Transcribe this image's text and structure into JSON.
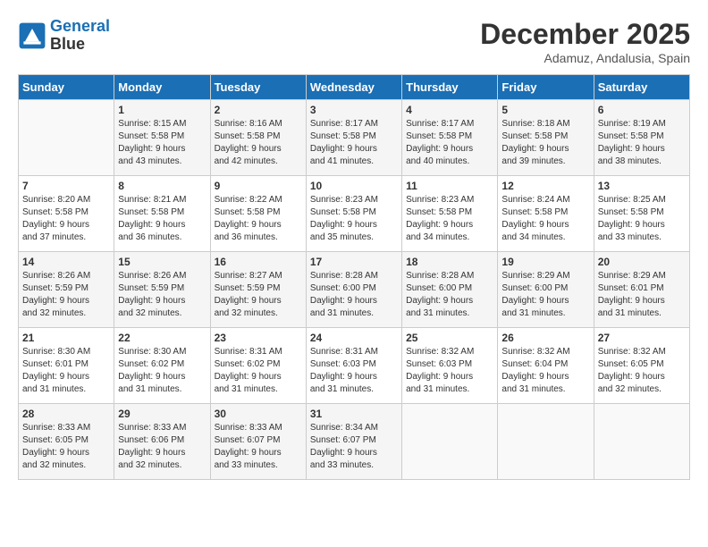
{
  "header": {
    "logo_line1": "General",
    "logo_line2": "Blue",
    "month": "December 2025",
    "location": "Adamuz, Andalusia, Spain"
  },
  "weekdays": [
    "Sunday",
    "Monday",
    "Tuesday",
    "Wednesday",
    "Thursday",
    "Friday",
    "Saturday"
  ],
  "weeks": [
    [
      {
        "day": "",
        "info": ""
      },
      {
        "day": "1",
        "info": "Sunrise: 8:15 AM\nSunset: 5:58 PM\nDaylight: 9 hours\nand 43 minutes."
      },
      {
        "day": "2",
        "info": "Sunrise: 8:16 AM\nSunset: 5:58 PM\nDaylight: 9 hours\nand 42 minutes."
      },
      {
        "day": "3",
        "info": "Sunrise: 8:17 AM\nSunset: 5:58 PM\nDaylight: 9 hours\nand 41 minutes."
      },
      {
        "day": "4",
        "info": "Sunrise: 8:17 AM\nSunset: 5:58 PM\nDaylight: 9 hours\nand 40 minutes."
      },
      {
        "day": "5",
        "info": "Sunrise: 8:18 AM\nSunset: 5:58 PM\nDaylight: 9 hours\nand 39 minutes."
      },
      {
        "day": "6",
        "info": "Sunrise: 8:19 AM\nSunset: 5:58 PM\nDaylight: 9 hours\nand 38 minutes."
      }
    ],
    [
      {
        "day": "7",
        "info": "Sunrise: 8:20 AM\nSunset: 5:58 PM\nDaylight: 9 hours\nand 37 minutes."
      },
      {
        "day": "8",
        "info": "Sunrise: 8:21 AM\nSunset: 5:58 PM\nDaylight: 9 hours\nand 36 minutes."
      },
      {
        "day": "9",
        "info": "Sunrise: 8:22 AM\nSunset: 5:58 PM\nDaylight: 9 hours\nand 36 minutes."
      },
      {
        "day": "10",
        "info": "Sunrise: 8:23 AM\nSunset: 5:58 PM\nDaylight: 9 hours\nand 35 minutes."
      },
      {
        "day": "11",
        "info": "Sunrise: 8:23 AM\nSunset: 5:58 PM\nDaylight: 9 hours\nand 34 minutes."
      },
      {
        "day": "12",
        "info": "Sunrise: 8:24 AM\nSunset: 5:58 PM\nDaylight: 9 hours\nand 34 minutes."
      },
      {
        "day": "13",
        "info": "Sunrise: 8:25 AM\nSunset: 5:58 PM\nDaylight: 9 hours\nand 33 minutes."
      }
    ],
    [
      {
        "day": "14",
        "info": "Sunrise: 8:26 AM\nSunset: 5:59 PM\nDaylight: 9 hours\nand 32 minutes."
      },
      {
        "day": "15",
        "info": "Sunrise: 8:26 AM\nSunset: 5:59 PM\nDaylight: 9 hours\nand 32 minutes."
      },
      {
        "day": "16",
        "info": "Sunrise: 8:27 AM\nSunset: 5:59 PM\nDaylight: 9 hours\nand 32 minutes."
      },
      {
        "day": "17",
        "info": "Sunrise: 8:28 AM\nSunset: 6:00 PM\nDaylight: 9 hours\nand 31 minutes."
      },
      {
        "day": "18",
        "info": "Sunrise: 8:28 AM\nSunset: 6:00 PM\nDaylight: 9 hours\nand 31 minutes."
      },
      {
        "day": "19",
        "info": "Sunrise: 8:29 AM\nSunset: 6:00 PM\nDaylight: 9 hours\nand 31 minutes."
      },
      {
        "day": "20",
        "info": "Sunrise: 8:29 AM\nSunset: 6:01 PM\nDaylight: 9 hours\nand 31 minutes."
      }
    ],
    [
      {
        "day": "21",
        "info": "Sunrise: 8:30 AM\nSunset: 6:01 PM\nDaylight: 9 hours\nand 31 minutes."
      },
      {
        "day": "22",
        "info": "Sunrise: 8:30 AM\nSunset: 6:02 PM\nDaylight: 9 hours\nand 31 minutes."
      },
      {
        "day": "23",
        "info": "Sunrise: 8:31 AM\nSunset: 6:02 PM\nDaylight: 9 hours\nand 31 minutes."
      },
      {
        "day": "24",
        "info": "Sunrise: 8:31 AM\nSunset: 6:03 PM\nDaylight: 9 hours\nand 31 minutes."
      },
      {
        "day": "25",
        "info": "Sunrise: 8:32 AM\nSunset: 6:03 PM\nDaylight: 9 hours\nand 31 minutes."
      },
      {
        "day": "26",
        "info": "Sunrise: 8:32 AM\nSunset: 6:04 PM\nDaylight: 9 hours\nand 31 minutes."
      },
      {
        "day": "27",
        "info": "Sunrise: 8:32 AM\nSunset: 6:05 PM\nDaylight: 9 hours\nand 32 minutes."
      }
    ],
    [
      {
        "day": "28",
        "info": "Sunrise: 8:33 AM\nSunset: 6:05 PM\nDaylight: 9 hours\nand 32 minutes."
      },
      {
        "day": "29",
        "info": "Sunrise: 8:33 AM\nSunset: 6:06 PM\nDaylight: 9 hours\nand 32 minutes."
      },
      {
        "day": "30",
        "info": "Sunrise: 8:33 AM\nSunset: 6:07 PM\nDaylight: 9 hours\nand 33 minutes."
      },
      {
        "day": "31",
        "info": "Sunrise: 8:34 AM\nSunset: 6:07 PM\nDaylight: 9 hours\nand 33 minutes."
      },
      {
        "day": "",
        "info": ""
      },
      {
        "day": "",
        "info": ""
      },
      {
        "day": "",
        "info": ""
      }
    ]
  ]
}
